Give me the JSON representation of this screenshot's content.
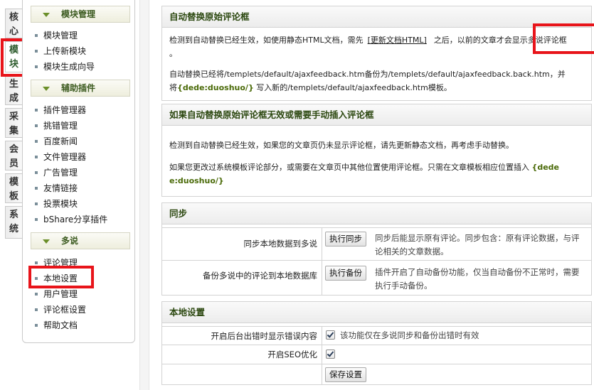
{
  "tabs": [
    {
      "label": [
        "核",
        "心"
      ]
    },
    {
      "label": [
        "模",
        "块"
      ]
    },
    {
      "label": [
        "生",
        "成"
      ]
    },
    {
      "label": [
        "采",
        "集"
      ]
    },
    {
      "label": [
        "会",
        "员"
      ]
    },
    {
      "label": [
        "模",
        "板"
      ]
    },
    {
      "label": [
        "系",
        "统"
      ]
    }
  ],
  "sidebar": {
    "groups": [
      {
        "title": "模块管理",
        "items": [
          "模块管理",
          "上传新模块",
          "模块生成向导"
        ]
      },
      {
        "title": "辅助插件",
        "items": [
          "插件管理器",
          "挑错管理",
          "百度新闻",
          "文件管理器",
          "广告管理",
          "友情链接",
          "投票模块",
          "bShare分享插件"
        ]
      },
      {
        "title": "多说",
        "items": [
          "评论管理",
          "本地设置",
          "用户管理",
          "评论框设置",
          "帮助文档"
        ]
      }
    ]
  },
  "main": {
    "auto_replace": {
      "title": "自动替换原始评论框",
      "p1_before": "检测到自动替换已经生效，如使用静态HTML文档，需先",
      "p1_link": "[更新文档HTML]",
      "p1_after": "之后，以前的文章才会显示多说评论框",
      "p1_end": "。",
      "p2_line1": "自动替换已经将/templets/default/ajaxfeedback.htm备份为/templets/default/ajaxfeedback.back.htm，并",
      "p2_pre": "将",
      "p2_code": "{dede:duoshuo/}",
      "p2_post": " 写入新的/templets/default/ajaxfeedback.htm模板。"
    },
    "manual_insert": {
      "title": "如果自动替换原始评论框无效或需要手动插入评论框",
      "p1": "检测到自动替换已经生效，如果您的文章页仍未显示评论框，请先更新静态文档，再考虑手动替换。",
      "p2_text": "如果您更改过系统模板评论部分，或需要在文章页中其他位置使用评论框。只需在文章模板相应位置插入 ",
      "p2_code_a": "{dede",
      "p2_code_b": "e:duoshuo/}"
    },
    "sync": {
      "title": "同步",
      "rows": [
        {
          "label": "同步本地数据到多说",
          "button": "执行同步",
          "desc_line1": "同步后能显示原有评论。同步包含：原有评论数据，与评",
          "desc_line2": "论相关的文章数据。"
        },
        {
          "label": "备份多说中的评论到本地数据库",
          "button": "执行备份",
          "desc_line1": "插件开启了自动备份功能，仅当自动备份不正常时，需要",
          "desc_line2": "执行手动备份。"
        }
      ]
    },
    "local_settings": {
      "title": "本地设置",
      "rows": [
        {
          "label": "开启后台出错时显示错误内容",
          "checked": true,
          "desc": "该功能仅在多说同步和备份出错时有效"
        },
        {
          "label": "开启SEO优化",
          "checked": true
        }
      ],
      "save_label": "保存设置"
    }
  },
  "colors": {
    "highlight_box": "#e8141a",
    "group_title": "#3b5a1f",
    "code_text": "#4a6a08"
  }
}
